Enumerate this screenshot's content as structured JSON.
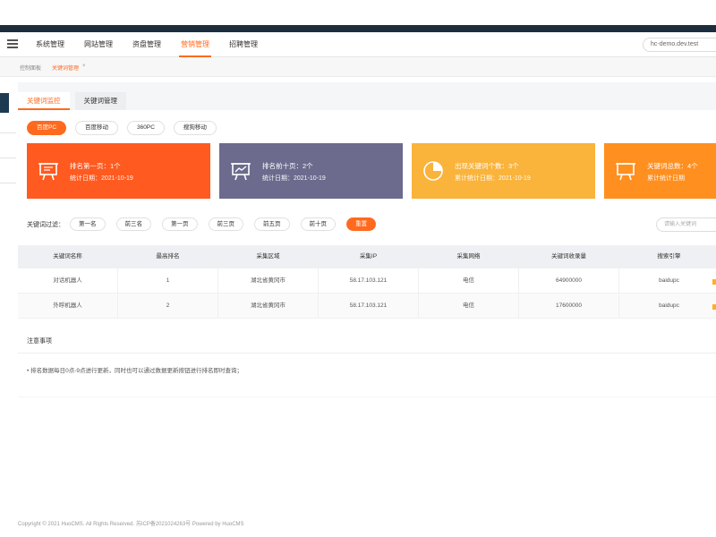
{
  "header": {
    "nav_items": [
      "系统管理",
      "网站管理",
      "资盘管理",
      "营销管理",
      "招聘管理"
    ],
    "active_nav": "营销管理",
    "domain": "hc-demo.dev.test"
  },
  "breadcrumb": {
    "home": "控制面板",
    "current": "关键词管理",
    "close": "×"
  },
  "tabs": [
    "关键词监控",
    "关键词管理"
  ],
  "engines": [
    "百度PC",
    "百度移动",
    "360PC",
    "搜狗移动"
  ],
  "cards": [
    {
      "title": "排名第一页：1个",
      "date": "统计日期：2021-10-19",
      "icon": "presentation-icon",
      "color": "#ff5a1f"
    },
    {
      "title": "排名前十页：2个",
      "date": "统计日期：2021-10-19",
      "icon": "chart-board-icon",
      "color": "#6c6b8e"
    },
    {
      "title": "出现关键词个数：3个",
      "date": "累计统计日期：2021-10-19",
      "icon": "pie-chart-icon",
      "color": "#fab33b"
    },
    {
      "title": "关键词总数：4个",
      "date": "累计统计日期",
      "icon": "presentation-icon",
      "color": "#ff8f1f"
    }
  ],
  "filter": {
    "label": "关键词过滤：",
    "options": [
      "第一名",
      "前三名",
      "第一页",
      "前三页",
      "前五页",
      "前十页"
    ],
    "reset": "重置",
    "search_placeholder": "请输入关键词"
  },
  "table": {
    "headers": [
      "关键词名称",
      "最高排名",
      "采集区域",
      "采集IP",
      "采集网络",
      "关键词收录量",
      "搜索引擎"
    ],
    "rows": [
      [
        "对话机器人",
        "1",
        "湖北省黄冈市",
        "58.17.103.121",
        "电信",
        "64900000",
        "baidupc"
      ],
      [
        "外呼机器人",
        "2",
        "湖北省黄冈市",
        "58.17.103.121",
        "电信",
        "17600000",
        "baidupc"
      ]
    ]
  },
  "notes": {
    "title": "注意事项",
    "text": "• 排名数据每日0点-9点进行更新，同时也可以通过数据更新按钮进行排名即时查询；"
  },
  "footer": "Copyright © 2021 HuoCMS. All Rights Reserved. 苏ICP备2021024263号 Powered by HuoCMS"
}
